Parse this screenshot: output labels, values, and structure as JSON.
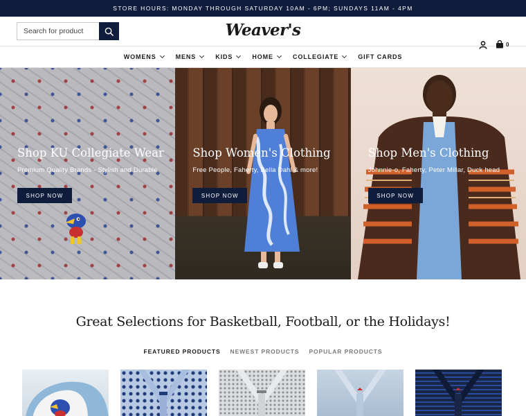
{
  "announcement": "STORE HOURS: MONDAY THROUGH SATURDAY 10AM - 6PM; SUNDAYS 11AM - 4PM",
  "header": {
    "search_placeholder": "Search for product",
    "logo": "Weaver's",
    "cart_count": "0",
    "icons": [
      "search-icon",
      "account-icon",
      "cart-icon"
    ]
  },
  "nav": {
    "items": [
      {
        "label": "WOMENS",
        "dropdown": true
      },
      {
        "label": "MENS",
        "dropdown": true
      },
      {
        "label": "KIDS",
        "dropdown": true
      },
      {
        "label": "HOME",
        "dropdown": true
      },
      {
        "label": "COLLEGIATE",
        "dropdown": true
      },
      {
        "label": "GIFT CARDS",
        "dropdown": false
      }
    ]
  },
  "hero": [
    {
      "title": "Shop KU Collegiate Wear",
      "subtitle": "Premium Quality Brands - Stylish and Durable",
      "button": "SHOP NOW"
    },
    {
      "title": "Shop Women's Clothing",
      "subtitle": "Free People, Faherty, Bella Dahl & more!",
      "button": "SHOP NOW"
    },
    {
      "title": "Shop Men's Clothing",
      "subtitle": "Johnnie-o, Faherty, Peter Millar, Duck head",
      "button": "SHOP NOW"
    }
  ],
  "selections_heading": "Great Selections for Basketball, Football, or the Holidays!",
  "tabs": [
    {
      "label": "FEATURED PRODUCTS",
      "active": true
    },
    {
      "label": "NEWEST PRODUCTS",
      "active": false
    },
    {
      "label": "POPULAR PRODUCTS",
      "active": false
    }
  ],
  "colors": {
    "navy": "#101c3b",
    "white": "#ffffff"
  }
}
